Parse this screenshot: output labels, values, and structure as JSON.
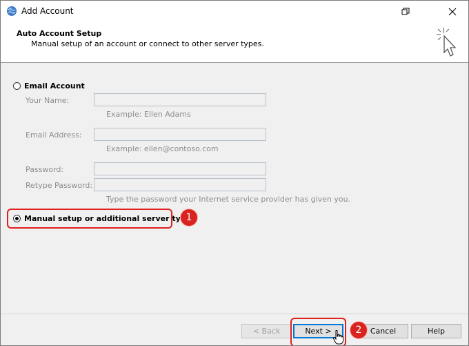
{
  "window": {
    "title": "Add Account",
    "icon": "outlook-globe-icon",
    "controls": [
      "restore-icon",
      "close-icon"
    ]
  },
  "header": {
    "title": "Auto Account Setup",
    "subtitle": "Manual setup of an account or connect to other server types."
  },
  "email_account": {
    "label": "Email Account",
    "selected": false,
    "your_name": {
      "label": "Your Name:",
      "value": "",
      "example": "Example: Ellen Adams"
    },
    "email_address": {
      "label": "Email Address:",
      "value": "",
      "example": "Example: ellen@contoso.com"
    },
    "password": {
      "label": "Password:",
      "value": ""
    },
    "retype_password": {
      "label": "Retype Password:",
      "value": ""
    },
    "password_hint": "Type the password your Internet service provider has given you."
  },
  "manual_setup": {
    "label": "Manual setup or additional server types",
    "selected": true
  },
  "annotations": {
    "step1": "1",
    "step2": "2",
    "highlight_color": "#e0201b",
    "badge_color": "#d8231f"
  },
  "buttons": {
    "back": "< Back",
    "next": "Next >",
    "cancel": "Cancel",
    "help": "Help"
  }
}
